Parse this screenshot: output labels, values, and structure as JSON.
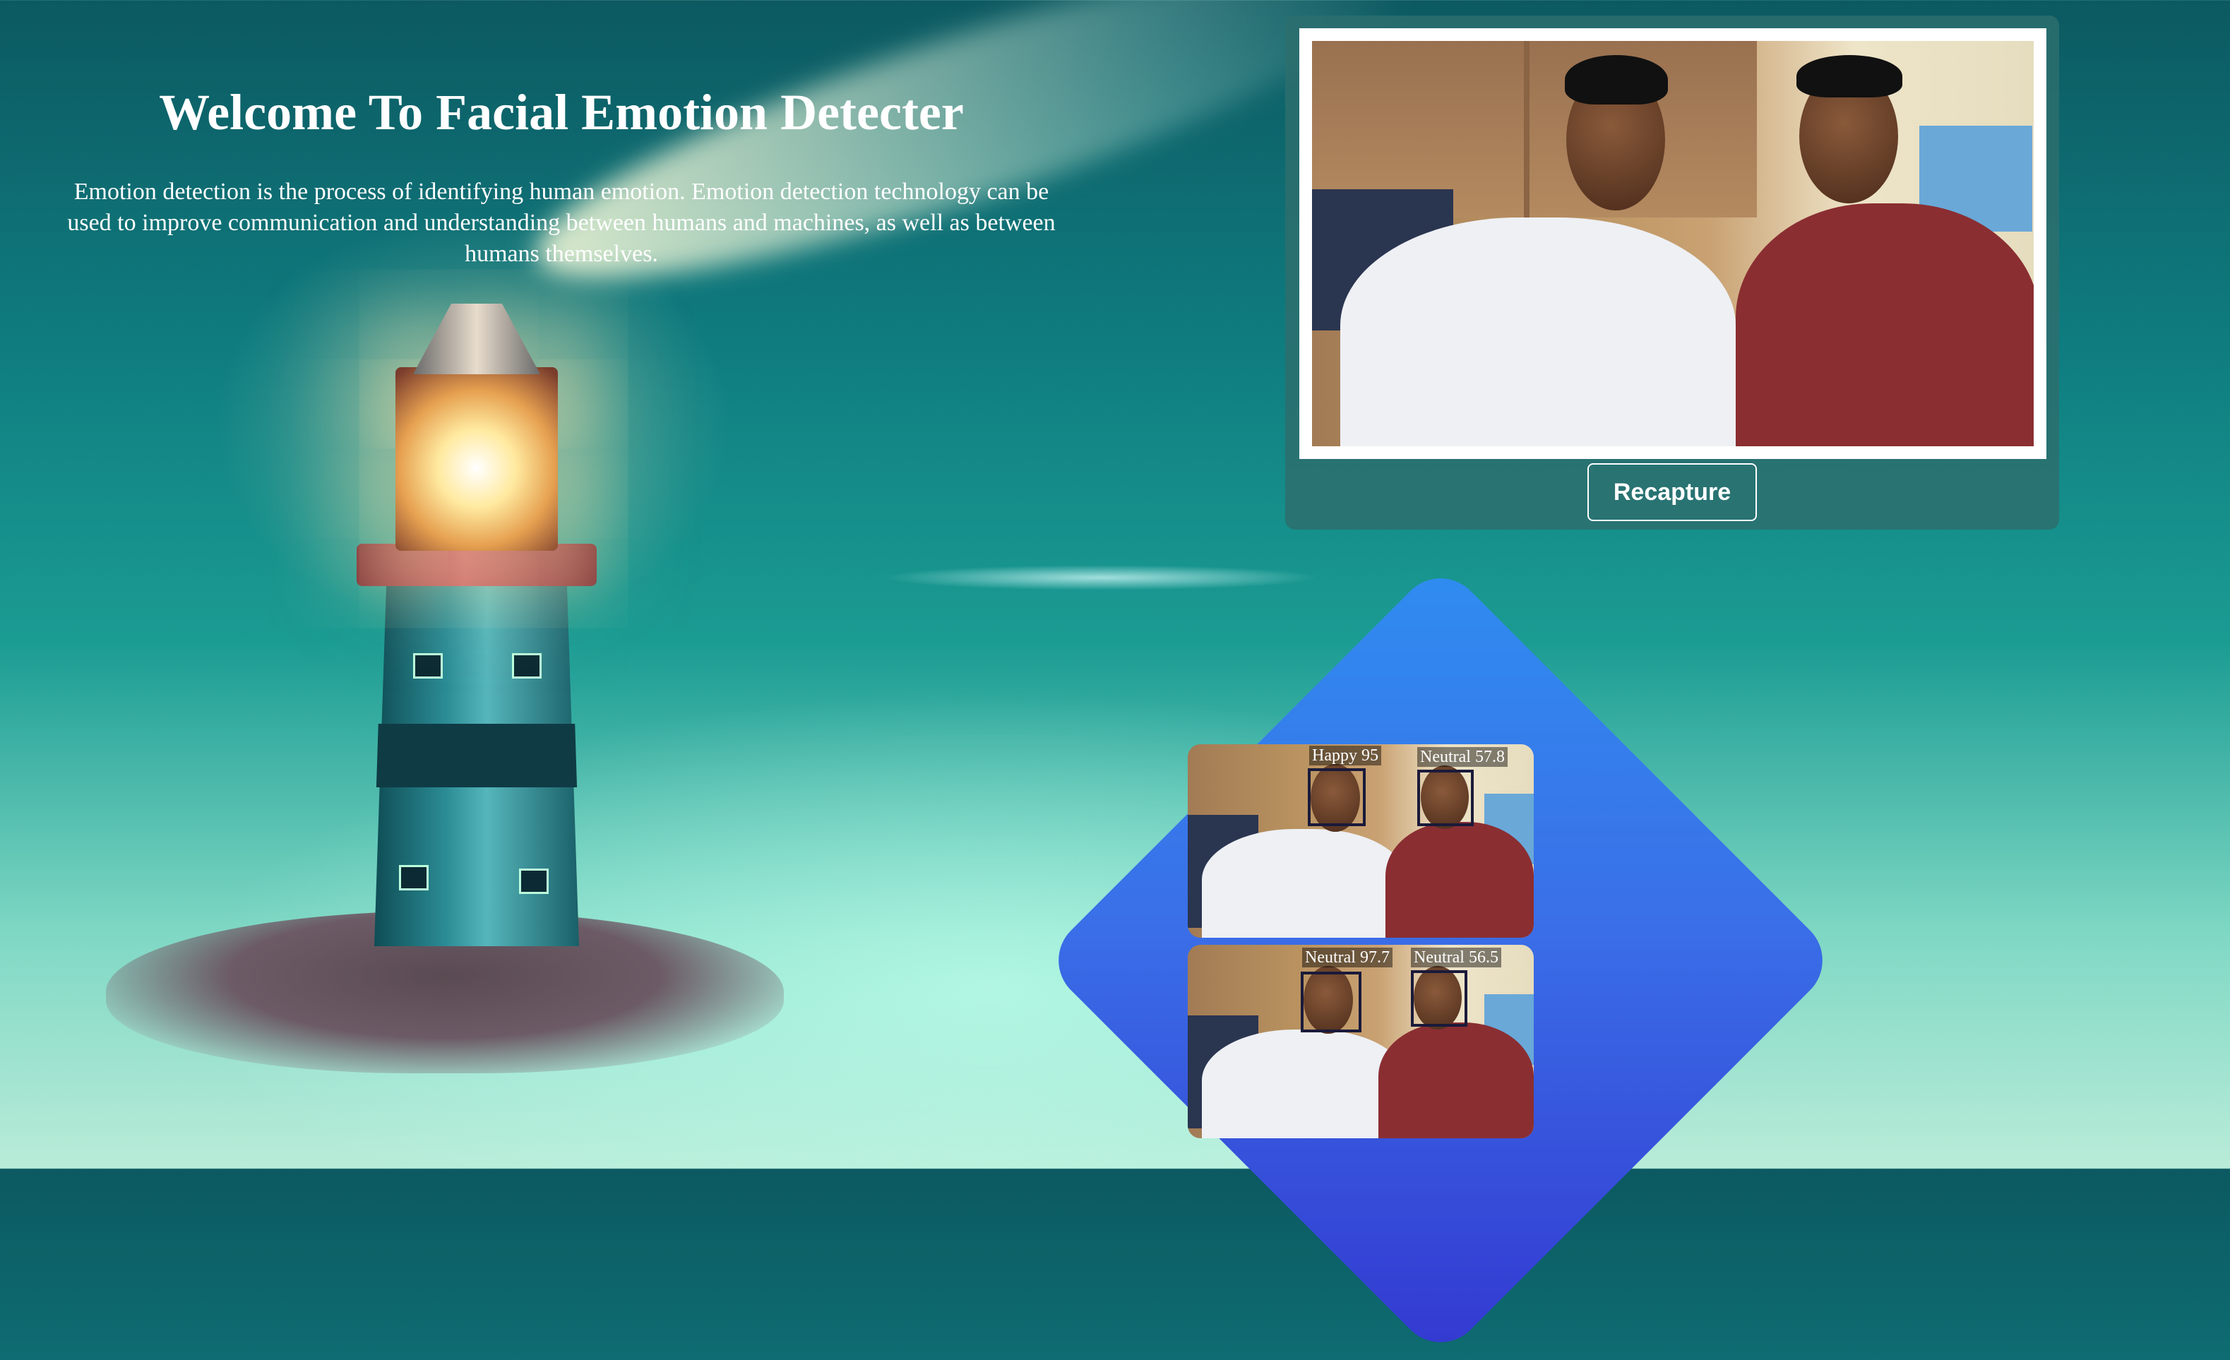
{
  "header": {
    "title": "Welcome To Facial Emotion Detecter",
    "description": "Emotion detection is the process of identifying human emotion. Emotion detection technology can be used to improve communication and understanding between humans and machines, as well as between humans themselves."
  },
  "capture": {
    "recapture_label": "Recapture"
  },
  "results": [
    {
      "faces": [
        {
          "label": "Happy 95"
        },
        {
          "label": "Neutral 57.8"
        }
      ]
    },
    {
      "faces": [
        {
          "label": "Neutral 97.7"
        },
        {
          "label": "Neutral 56.5"
        }
      ]
    }
  ],
  "colors": {
    "accent_gradient_start": "#2f8df0",
    "accent_gradient_end": "#3338d0",
    "panel": "#2d6e6e"
  }
}
